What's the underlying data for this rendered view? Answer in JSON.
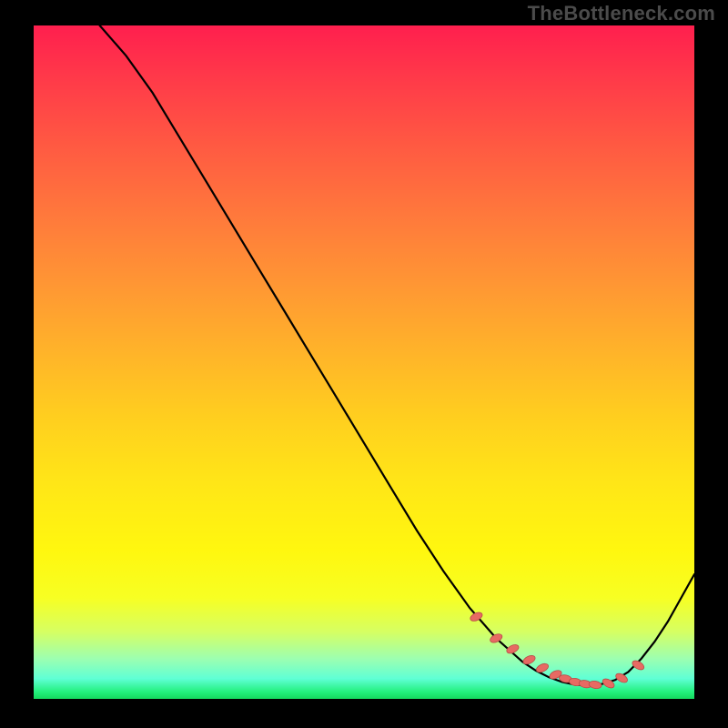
{
  "watermark": "TheBottleneck.com",
  "chart_data": {
    "type": "line",
    "title": "",
    "xlabel": "",
    "ylabel": "",
    "xlim": [
      0,
      100
    ],
    "ylim": [
      0,
      100
    ],
    "grid": false,
    "legend": false,
    "series": [
      {
        "name": "curve",
        "x": [
          10,
          14,
          18,
          22,
          26,
          30,
          34,
          38,
          42,
          46,
          50,
          54,
          58,
          62,
          66,
          70,
          74,
          76,
          78,
          80,
          82,
          84,
          86,
          88,
          90,
          92,
          94,
          96,
          98,
          100
        ],
        "y": [
          100,
          95.5,
          90,
          83.5,
          77,
          70.5,
          64,
          57.5,
          51,
          44.5,
          38,
          31.5,
          25,
          19,
          13.5,
          9,
          5.5,
          4.2,
          3.2,
          2.5,
          2.1,
          2.0,
          2.2,
          2.8,
          4.0,
          6.0,
          8.5,
          11.5,
          15,
          18.5
        ]
      }
    ],
    "markers": {
      "name": "highlight-dots",
      "x": [
        67,
        70,
        72.5,
        75,
        77,
        79,
        80.5,
        82,
        83.5,
        85,
        87,
        89,
        91.5
      ],
      "y": [
        12.2,
        9.0,
        7.4,
        5.8,
        4.6,
        3.6,
        3.0,
        2.5,
        2.2,
        2.1,
        2.3,
        3.1,
        5.0
      ]
    },
    "colors": {
      "curve": "#000000",
      "markers": "#e76a63",
      "gradient_top": "#ff1f4e",
      "gradient_bottom": "#15d85e"
    }
  }
}
